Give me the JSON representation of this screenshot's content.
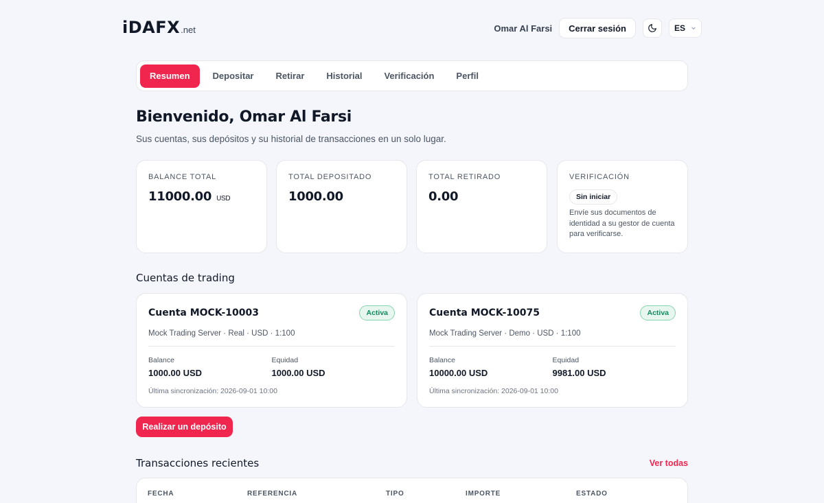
{
  "header": {
    "logo_main": "iDAFX",
    "logo_sub": ".net",
    "user_name": "Omar Al Farsi",
    "logout_label": "Cerrar sesión",
    "theme_icon": "moon-icon",
    "lang_label": "ES",
    "accent_color": "#f0264f"
  },
  "nav": {
    "tabs": [
      {
        "label": "Resumen",
        "active": true
      },
      {
        "label": "Depositar",
        "active": false
      },
      {
        "label": "Retirar",
        "active": false
      },
      {
        "label": "Historial",
        "active": false
      },
      {
        "label": "Verificación",
        "active": false
      },
      {
        "label": "Perfil",
        "active": false
      }
    ]
  },
  "welcome": {
    "title": "Bienvenido, Omar Al Farsi",
    "subtitle": "Sus cuentas, sus depósitos y su historial de transacciones en un solo lugar."
  },
  "stats": {
    "balance": {
      "label": "Balance total",
      "value": "11000.00",
      "unit": "USD"
    },
    "deposited": {
      "label": "Total depositado",
      "value": "1000.00"
    },
    "withdrawn": {
      "label": "Total retirado",
      "value": "0.00"
    },
    "verification": {
      "label": "Verificación",
      "status": "Sin iniciar",
      "text": "Envíe sus documentos de identidad a su gestor de cuenta para verificarse."
    }
  },
  "accounts": {
    "title": "Cuentas de trading",
    "items": [
      {
        "name": "Cuenta MOCK-10003",
        "status": "Activa",
        "meta": "Mock Trading Server · Real · USD · 1:100",
        "balance_label": "Balance",
        "balance": "1000.00 USD",
        "equity_label": "Equidad",
        "equity": "1000.00 USD",
        "sync": "Última sincronización: 2026-09-01 10:00"
      },
      {
        "name": "Cuenta MOCK-10075",
        "status": "Activa",
        "meta": "Mock Trading Server · Demo · USD · 1:100",
        "balance_label": "Balance",
        "balance": "10000.00 USD",
        "equity_label": "Equidad",
        "equity": "9981.00 USD",
        "sync": "Última sincronización: 2026-09-01 10:00"
      }
    ]
  },
  "deposit_button": "Realizar un depósito",
  "transactions": {
    "title": "Transacciones recientes",
    "view_all": "Ver todas",
    "columns": [
      "FECHA",
      "REFERENCIA",
      "TIPO",
      "IMPORTE",
      "ESTADO"
    ]
  }
}
